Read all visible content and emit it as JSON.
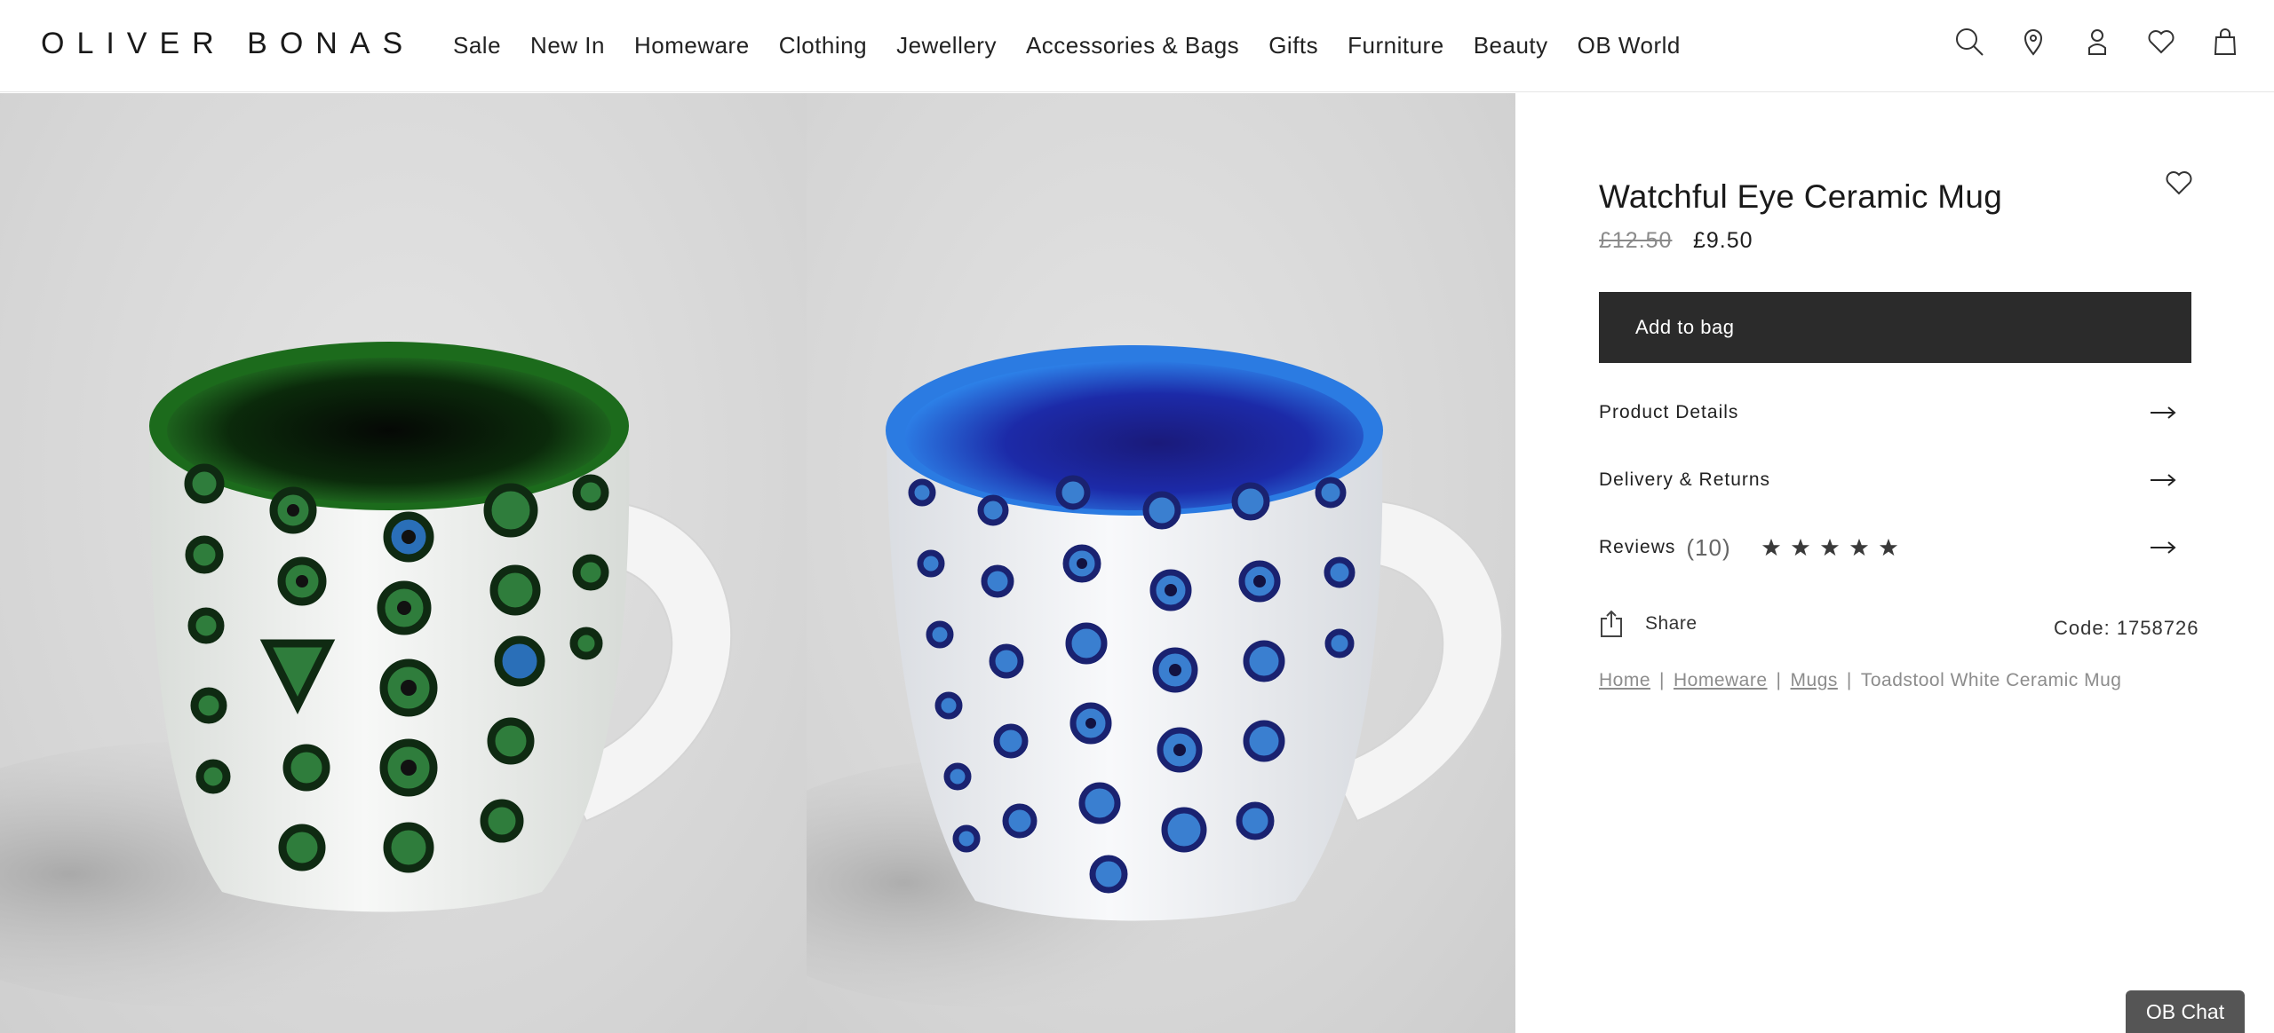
{
  "brand": {
    "name": "OLIVER BONAS"
  },
  "nav": {
    "items": [
      "Sale",
      "New In",
      "Homeware",
      "Clothing",
      "Jewellery",
      "Accessories & Bags",
      "Gifts",
      "Furniture",
      "Beauty",
      "OB World"
    ]
  },
  "header_icons": [
    "search-icon",
    "store-location-icon",
    "account-icon",
    "wishlist-icon",
    "bag-icon"
  ],
  "product": {
    "title": "Watchful Eye Ceramic Mug",
    "price_old": "£12.50",
    "price_new": "£9.50",
    "add_to_bag": "Add to bag",
    "details_label": "Product Details",
    "delivery_label": "Delivery & Returns",
    "reviews_label": "Reviews",
    "reviews_count": "(10)",
    "rating": 5,
    "share_label": "Share",
    "code": "Code: 1758726"
  },
  "breadcrumb": {
    "home": "Home",
    "homeware": "Homeware",
    "mugs": "Mugs",
    "sep": "|",
    "current": "Toadstool White Ceramic Mug"
  },
  "chat": {
    "label": "OB Chat"
  },
  "colors": {
    "button_bg": "#2b2b2b",
    "mug_green": "#1e6b1e",
    "mug_blue": "#1f6fd6",
    "chat_bg": "#555555"
  }
}
